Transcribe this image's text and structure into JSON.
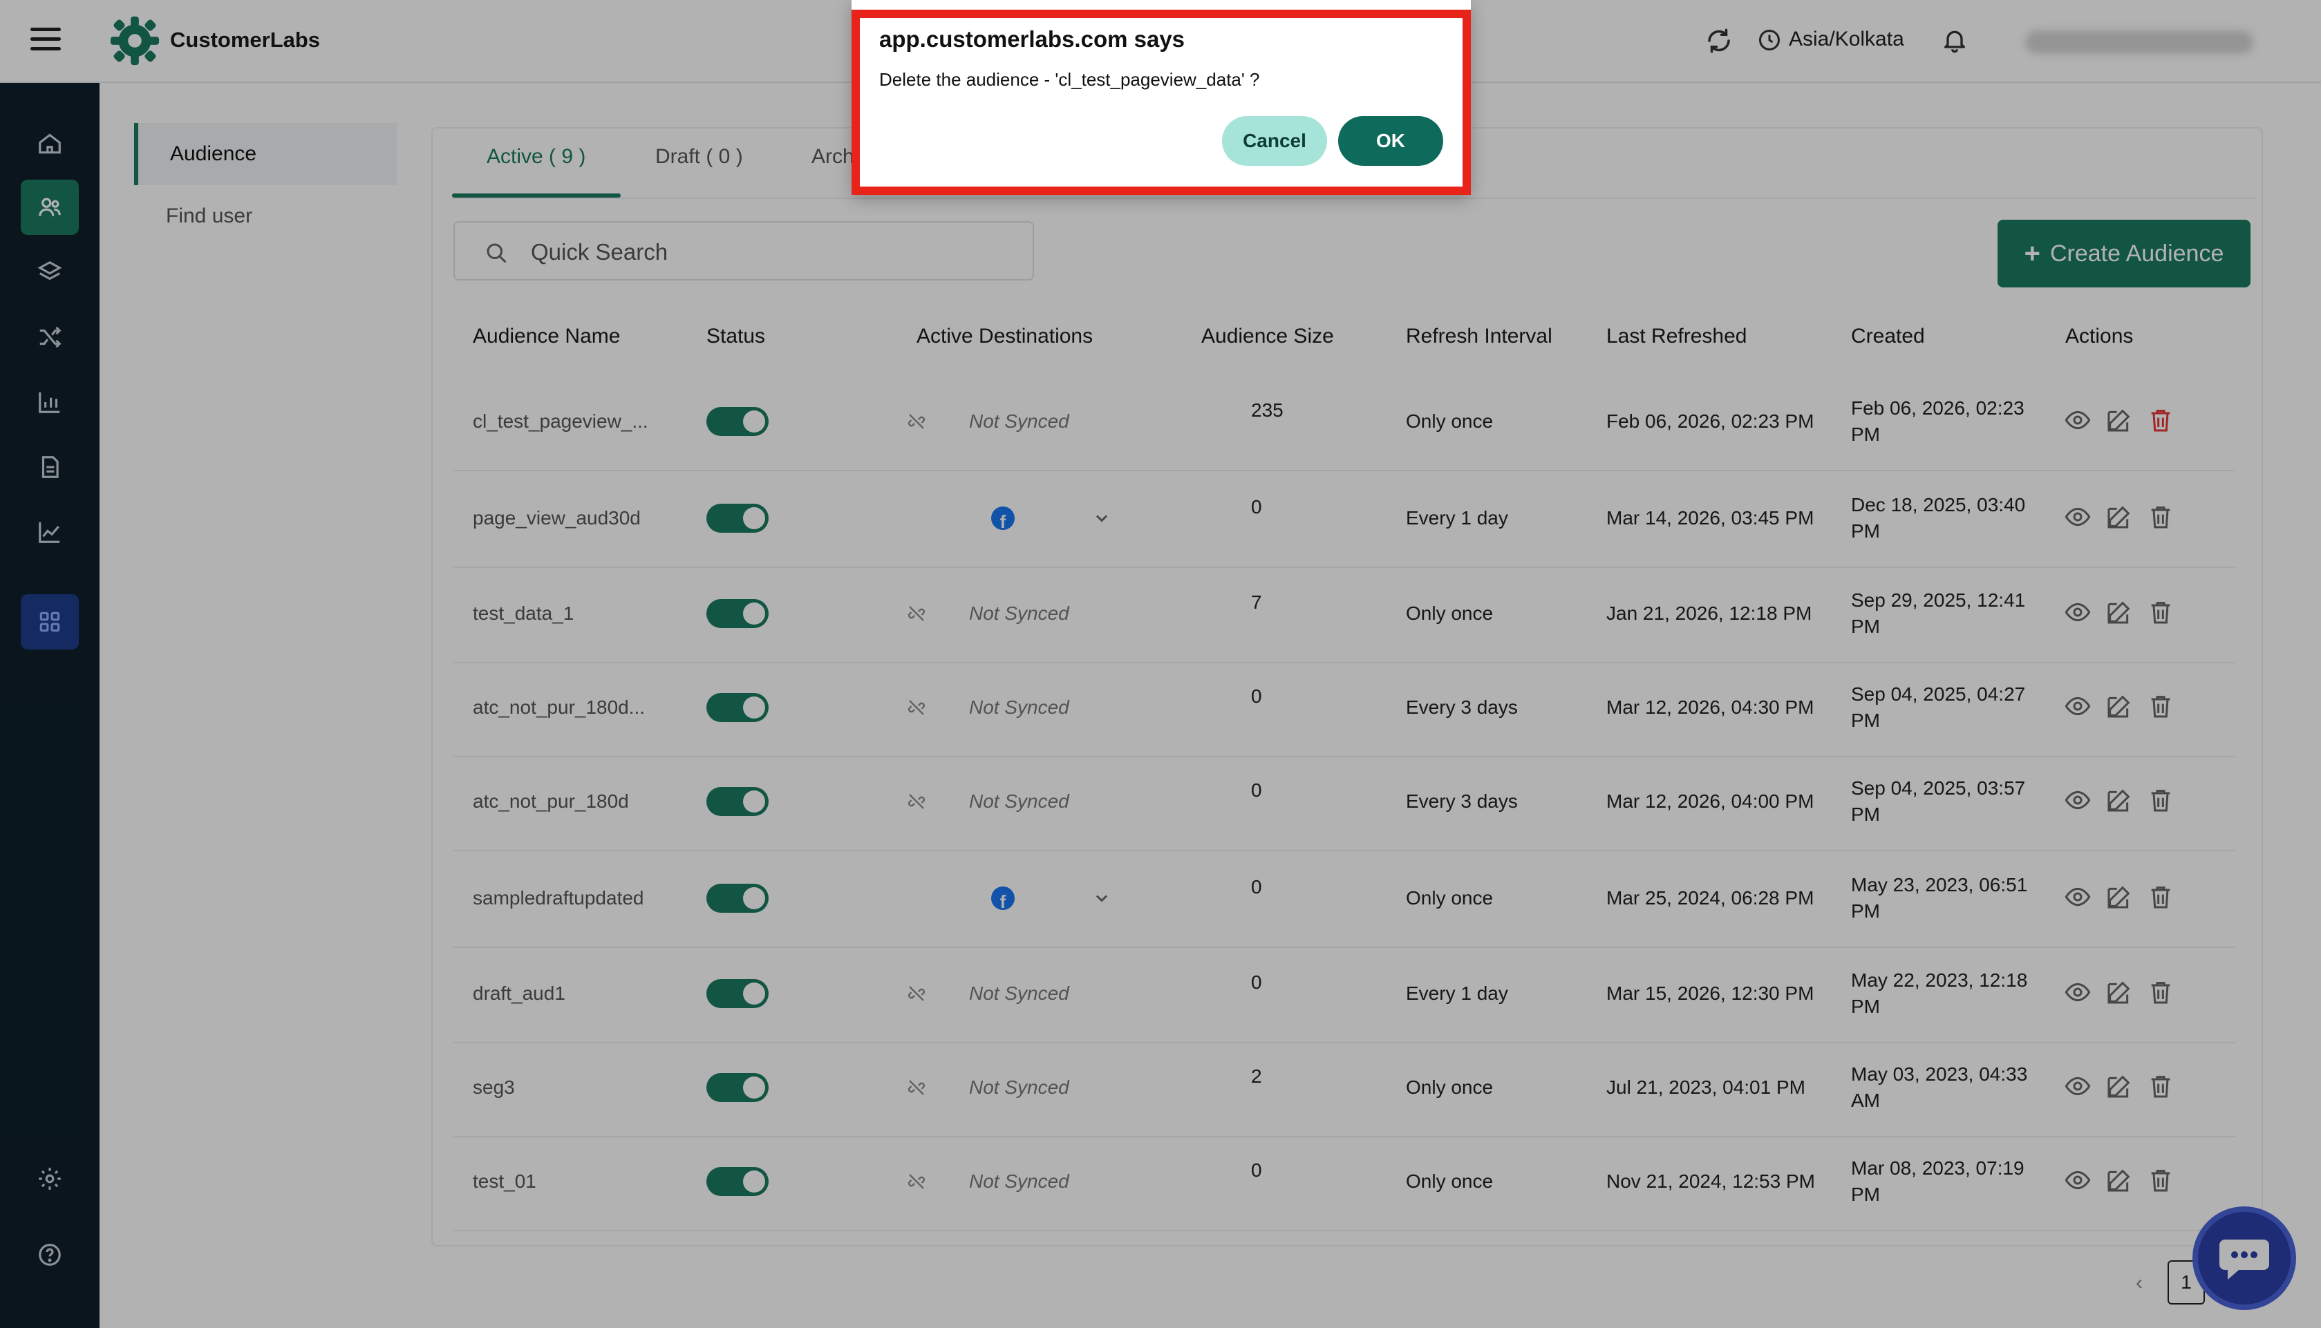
{
  "header": {
    "brand": "CustomerLabs",
    "timezone": "Asia/Kolkata"
  },
  "rail": {
    "icons": [
      "home-icon",
      "users-icon",
      "layers-icon",
      "shuffle-icon",
      "bar-chart-icon",
      "document-icon",
      "line-chart-icon",
      "apps-grid-icon",
      "gear-icon",
      "help-icon"
    ]
  },
  "subnav": {
    "items": [
      {
        "label": "Audience"
      },
      {
        "label": "Find user"
      }
    ]
  },
  "tabs": [
    {
      "label": "Active ( 9 )"
    },
    {
      "label": "Draft ( 0 )"
    },
    {
      "label": "Arch"
    }
  ],
  "search": {
    "placeholder": "Quick Search"
  },
  "create_button": {
    "label": "Create Audience"
  },
  "table": {
    "columns": [
      "Audience Name",
      "Status",
      "Active Destinations",
      "Audience Size",
      "Refresh Interval",
      "Last Refreshed",
      "Created",
      "Actions"
    ],
    "rows": [
      {
        "name": "cl_test_pageview_...",
        "destination": "Not Synced",
        "size": "235",
        "interval": "Only once",
        "last": "Feb 06, 2026, 02:23 PM",
        "created": "Feb 06, 2026, 02:23 PM"
      },
      {
        "name": "page_view_aud30d",
        "destination": "facebook",
        "size": "0",
        "interval": "Every 1 day",
        "last": "Mar 14, 2026, 03:45 PM",
        "created": "Dec 18, 2025, 03:40 PM"
      },
      {
        "name": "test_data_1",
        "destination": "Not Synced",
        "size": "7",
        "interval": "Only once",
        "last": "Jan 21, 2026, 12:18 PM",
        "created": "Sep 29, 2025, 12:41 PM"
      },
      {
        "name": "atc_not_pur_180d...",
        "destination": "Not Synced",
        "size": "0",
        "interval": "Every 3 days",
        "last": "Mar 12, 2026, 04:30 PM",
        "created": "Sep 04, 2025, 04:27 PM"
      },
      {
        "name": "atc_not_pur_180d",
        "destination": "Not Synced",
        "size": "0",
        "interval": "Every 3 days",
        "last": "Mar 12, 2026, 04:00 PM",
        "created": "Sep 04, 2025, 03:57 PM"
      },
      {
        "name": "sampledraftupdated",
        "destination": "facebook",
        "size": "0",
        "interval": "Only once",
        "last": "Mar 25, 2024, 06:28 PM",
        "created": "May 23, 2023, 06:51 PM"
      },
      {
        "name": "draft_aud1",
        "destination": "Not Synced",
        "size": "0",
        "interval": "Every 1 day",
        "last": "Mar 15, 2026, 12:30 PM",
        "created": "May 22, 2023, 12:18 PM"
      },
      {
        "name": "seg3",
        "destination": "Not Synced",
        "size": "2",
        "interval": "Only once",
        "last": "Jul 21, 2023, 04:01 PM",
        "created": "May 03, 2023, 04:33 AM"
      },
      {
        "name": "test_01",
        "destination": "Not Synced",
        "size": "0",
        "interval": "Only once",
        "last": "Nov 21, 2024, 12:53 PM",
        "created": "Mar 08, 2023, 07:19 PM"
      }
    ]
  },
  "pagination": {
    "prev": "‹",
    "current": "1"
  },
  "dialog": {
    "title": "app.customerlabs.com says",
    "message": "Delete the audience - 'cl_test_pageview_data' ?",
    "cancel_label": "Cancel",
    "ok_label": "OK"
  },
  "colors": {
    "brand_green": "#1b7a5f",
    "rail_bg": "#0f1f2b",
    "alert_red": "#e8231a",
    "ok_button": "#0e6b5c",
    "cancel_button": "#a6e3d8"
  }
}
